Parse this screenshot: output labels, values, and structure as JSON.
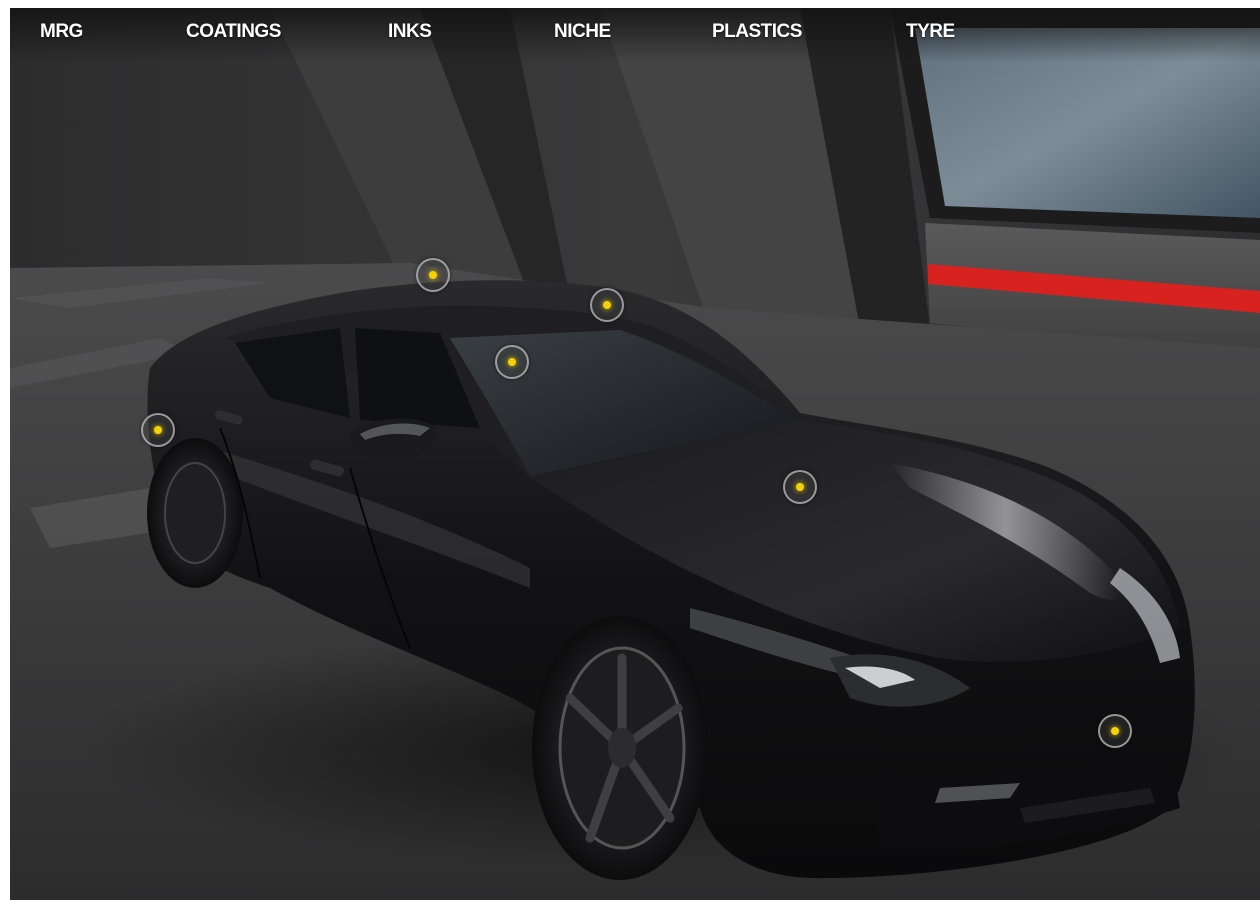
{
  "nav": {
    "items": [
      {
        "label": "MRG"
      },
      {
        "label": "COATINGS"
      },
      {
        "label": "INKS"
      },
      {
        "label": "NICHE"
      },
      {
        "label": "PLASTICS"
      },
      {
        "label": "TYRE"
      }
    ]
  },
  "colors": {
    "nav_text": "#ffffff",
    "hotspot_dot": "#f2d200",
    "accent_stripe": "#d8221f",
    "car_body": "#141416"
  },
  "icons": {
    "hotspot": "hotspot-marker-icon"
  }
}
